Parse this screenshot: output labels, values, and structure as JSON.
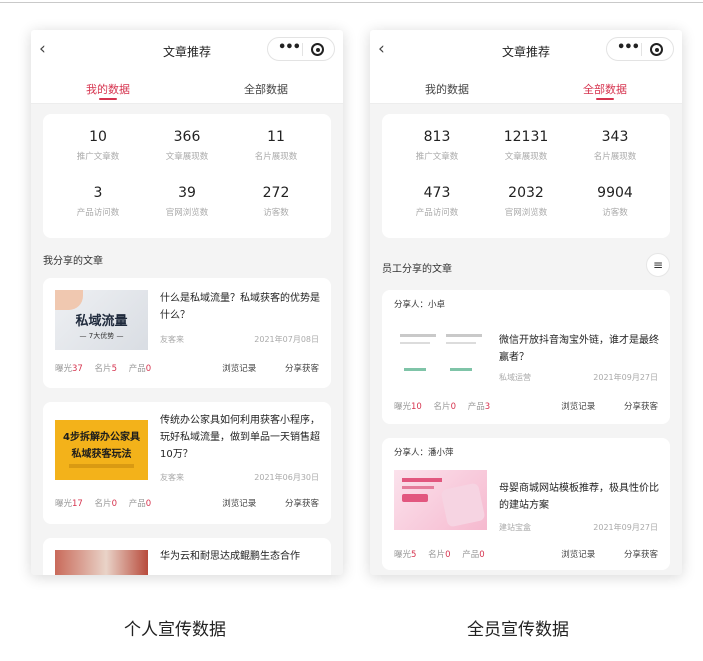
{
  "colors": {
    "accent": "#d6344f",
    "card_bg": "#ffffff",
    "page_bg": "#f4f4f4"
  },
  "left": {
    "nav_title": "文章推荐",
    "tabs": [
      {
        "label": "我的数据",
        "active": true
      },
      {
        "label": "全部数据",
        "active": false
      }
    ],
    "stats": [
      {
        "value": "10",
        "label": "推广文章数"
      },
      {
        "value": "366",
        "label": "文章展现数"
      },
      {
        "value": "11",
        "label": "名片展现数"
      },
      {
        "value": "3",
        "label": "产品访问数"
      },
      {
        "value": "39",
        "label": "官网浏览数"
      },
      {
        "value": "272",
        "label": "访客数"
      }
    ],
    "section_title": "我分享的文章",
    "articles": [
      {
        "title": "什么是私域流量？私域获客的优势是什么？",
        "author": "友客来",
        "date": "2021年07月08日",
        "thumb": {
          "line1": "私域流量",
          "line2": "— 7大优势 —"
        },
        "metrics": [
          {
            "label": "曝光",
            "value": "37"
          },
          {
            "label": "名片",
            "value": "5"
          },
          {
            "label": "产品",
            "value": "0"
          }
        ],
        "actions": [
          "浏览记录",
          "分享获客"
        ]
      },
      {
        "title": "传统办公家具如何利用获客小程序，玩好私域流量，做到单品一天销售超10万？",
        "author": "友客来",
        "date": "2021年06月30日",
        "thumb": {
          "line1": "4步拆解办公家具",
          "line2": "私域获客玩法"
        },
        "metrics": [
          {
            "label": "曝光",
            "value": "17"
          },
          {
            "label": "名片",
            "value": "0"
          },
          {
            "label": "产品",
            "value": "0"
          }
        ],
        "actions": [
          "浏览记录",
          "分享获客"
        ]
      },
      {
        "title": "华为云和耐思达成鲲鹏生态合作"
      }
    ]
  },
  "right": {
    "nav_title": "文章推荐",
    "tabs": [
      {
        "label": "我的数据",
        "active": false
      },
      {
        "label": "全部数据",
        "active": true
      }
    ],
    "stats": [
      {
        "value": "813",
        "label": "推广文章数"
      },
      {
        "value": "12131",
        "label": "文章展现数"
      },
      {
        "value": "343",
        "label": "名片展现数"
      },
      {
        "value": "473",
        "label": "产品访问数"
      },
      {
        "value": "2032",
        "label": "官网浏览数"
      },
      {
        "value": "9904",
        "label": "访客数"
      }
    ],
    "section_title": "员工分享的文章",
    "articles": [
      {
        "sharer": "分享人：小卓",
        "title": "微信开放抖音淘宝外链，谁才是最终赢者？",
        "author": "私域运营",
        "date": "2021年09月27日",
        "metrics": [
          {
            "label": "曝光",
            "value": "10"
          },
          {
            "label": "名片",
            "value": "0"
          },
          {
            "label": "产品",
            "value": "3"
          }
        ],
        "actions": [
          "浏览记录",
          "分享获客"
        ]
      },
      {
        "sharer": "分享人：潘小萍",
        "title": "母婴商城网站模板推荐，极具性价比的建站方案",
        "author": "建站宝盒",
        "date": "2021年09月27日",
        "metrics": [
          {
            "label": "曝光",
            "value": "5"
          },
          {
            "label": "名片",
            "value": "0"
          },
          {
            "label": "产品",
            "value": "0"
          }
        ],
        "actions": [
          "浏览记录",
          "分享获客"
        ]
      }
    ]
  },
  "captions": {
    "left": "个人宣传数据",
    "right": "全员宣传数据"
  }
}
